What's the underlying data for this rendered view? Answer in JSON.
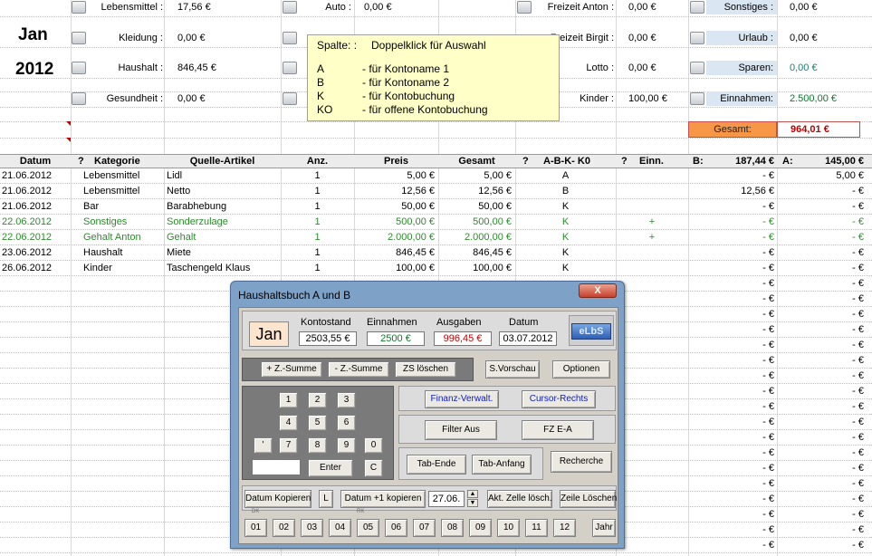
{
  "summary": {
    "month": "Jan",
    "year": "2012",
    "items": [
      {
        "label": "Lebensmittel :",
        "value": "17,56 €"
      },
      {
        "label": "Kleidung :",
        "value": "0,00 €"
      },
      {
        "label": "Haushalt :",
        "value": "846,45 €"
      },
      {
        "label": "Gesundheit :",
        "value": "0,00 €"
      },
      {
        "label": "Auto :",
        "value": "0,00 €"
      },
      {
        "label": "Freizeit Anton :",
        "value": "0,00 €"
      },
      {
        "label": "Freizeit Birgit :",
        "value": "0,00 €"
      },
      {
        "label": "Lotto :",
        "value": "0,00 €"
      },
      {
        "label": "Kinder :",
        "value": "100,00 €"
      },
      {
        "label": "Sonstiges :",
        "value": "0,00 €"
      },
      {
        "label": "Urlaub :",
        "value": "0,00 €"
      },
      {
        "label": "Sparen:",
        "value": "0,00 €"
      },
      {
        "label": "Einnahmen:",
        "value": "2.500,00 €"
      }
    ],
    "gesamt_label": "Gesamt:",
    "gesamt_value": "964,01 €"
  },
  "tooltip": {
    "title_key": "Spalte: :",
    "title_value": "Doppelklick für Auswahl",
    "lines": [
      {
        "k": "A",
        "v": "- für Kontoname 1"
      },
      {
        "k": "B",
        "v": "- für Kontoname 2"
      },
      {
        "k": "K",
        "v": "- für Kontobuchung"
      },
      {
        "k": "KO",
        "v": "- für offene Kontobuchung"
      }
    ]
  },
  "table": {
    "headers": {
      "datum": "Datum",
      "q1": "?",
      "kategorie": "Kategorie",
      "quelle": "Quelle-Artikel",
      "anz": "Anz.",
      "preis": "Preis",
      "gesamt": "Gesamt",
      "q2": "?",
      "abk": "A-B-K- K0",
      "q3": "?",
      "einn": "Einn.",
      "b_label": "B:",
      "b_value": "187,44 €",
      "a_label": "A:",
      "a_value": "145,00 €"
    },
    "rows": [
      {
        "datum": "21.06.2012",
        "kategorie": "Lebensmittel",
        "quelle": "Lidl",
        "anz": "1",
        "preis": "5,00 €",
        "gesamt": "5,00 €",
        "abk": "A",
        "einn": "",
        "b": "-   €",
        "a": "5,00 €",
        "green": false
      },
      {
        "datum": "21.06.2012",
        "kategorie": "Lebensmittel",
        "quelle": "Netto",
        "anz": "1",
        "preis": "12,56 €",
        "gesamt": "12,56 €",
        "abk": "B",
        "einn": "",
        "b": "12,56 €",
        "a": "-   €",
        "green": false
      },
      {
        "datum": "21.06.2012",
        "kategorie": "Bar",
        "quelle": "Barabhebung",
        "anz": "1",
        "preis": "50,00 €",
        "gesamt": "50,00 €",
        "abk": "K",
        "einn": "",
        "b": "-   €",
        "a": "-   €",
        "green": false
      },
      {
        "datum": "22.06.2012",
        "kategorie": "Sonstiges",
        "quelle": "Sonderzulage",
        "anz": "1",
        "preis": "500,00 €",
        "gesamt": "500,00 €",
        "abk": "K",
        "einn": "+",
        "b": "-   €",
        "a": "-   €",
        "green": true
      },
      {
        "datum": "22.06.2012",
        "kategorie": "Gehalt Anton",
        "quelle": "Gehalt",
        "anz": "1",
        "preis": "2.000,00 €",
        "gesamt": "2.000,00 €",
        "abk": "K",
        "einn": "+",
        "b": "-   €",
        "a": "-   €",
        "green": true
      },
      {
        "datum": "23.06.2012",
        "kategorie": "Haushalt",
        "quelle": "Miete",
        "anz": "1",
        "preis": "846,45 €",
        "gesamt": "846,45 €",
        "abk": "K",
        "einn": "",
        "b": "-   €",
        "a": "-   €",
        "green": false
      },
      {
        "datum": "26.06.2012",
        "kategorie": "Kinder",
        "quelle": "Taschengeld Klaus",
        "anz": "1",
        "preis": "100,00 €",
        "gesamt": "100,00 €",
        "abk": "K",
        "einn": "",
        "b": "-   €",
        "a": "-   €",
        "green": false
      }
    ],
    "empty_row_b": "-   €",
    "empty_row_a": "-   €"
  },
  "dialog": {
    "title": "Haushaltsbuch A und B",
    "close_label": "X",
    "month": "Jan",
    "kontostand_label": "Kontostand",
    "kontostand_value": "2503,55 €",
    "einnahmen_label": "Einnahmen",
    "einnahmen_value": "2500 €",
    "ausgaben_label": "Ausgaben",
    "ausgaben_value": "996,45 €",
    "datum_label": "Datum",
    "datum_value": "03.07.2012",
    "logo": "eLbS",
    "buttons": {
      "plus_zsumme": "+ Z.-Summe",
      "minus_zsumme": "- Z.-Summe",
      "zs_loeschen": "ZS löschen",
      "s_vorschau": "S.Vorschau",
      "optionen": "Optionen",
      "finanz": "Finanz-Verwalt.",
      "cursor": "Cursor-Rechts",
      "filter": "Filter Aus",
      "fz": "FZ E-A",
      "tab_ende": "Tab-Ende",
      "tab_anfang": "Tab-Anfang",
      "recherche": "Recherche",
      "enter": "Enter",
      "clear": "C",
      "datum_kopieren": "Datum Kopieren",
      "l": "L",
      "datum_plus1": "Datum +1 kopieren",
      "date_field": "27.06.",
      "akt_zelle": "Akt. Zelle lösch.",
      "zeile_loeschen": "Zeile Löschen",
      "jahr": "Jahr"
    },
    "numpad": [
      "1",
      "2",
      "3",
      "4",
      "5",
      "6",
      "'",
      "7",
      "8",
      "9",
      "0"
    ],
    "months": [
      "01",
      "02",
      "03",
      "04",
      "05",
      "06",
      "07",
      "08",
      "09",
      "10",
      "11",
      "12"
    ],
    "tiny_dk": "DK",
    "tiny_rk": "RK"
  }
}
